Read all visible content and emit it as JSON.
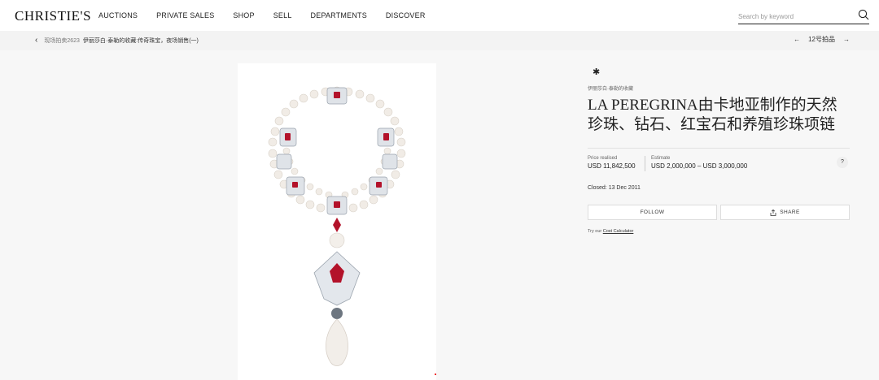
{
  "header": {
    "logo": "CHRISTIE'S",
    "nav": [
      "AUCTIONS",
      "PRIVATE SALES",
      "SHOP",
      "SELL",
      "DEPARTMENTS",
      "DISCOVER"
    ],
    "search_placeholder": "Search by keyword"
  },
  "breadcrumb": {
    "sale_number": "现场拍卖2623",
    "sale_title": "伊丽莎白·泰勒的收藏:传奇珠宝，夜场销售(一)",
    "lot_label": "12号拍品"
  },
  "lot": {
    "collection": "伊丽莎白·泰勒的收藏",
    "title": "LA PEREGRINA由卡地亚制作的天然珍珠、钻石、红宝石和养殖珍珠项链",
    "price_label": "Price realised",
    "price_value": "USD 11,842,500",
    "estimate_label": "Estimate",
    "estimate_value": "USD 2,000,000 – USD 3,000,000",
    "closed_label": "Closed:",
    "closed_date": "13 Dec 2011",
    "follow_label": "FOLLOW",
    "share_label": "SHARE",
    "calc_prefix": "Try our",
    "calc_link": "Cost Calculator",
    "help": "?"
  },
  "colors": {
    "accent": "#222222",
    "background": "#f7f7f7",
    "ruby": "#b3122a"
  }
}
